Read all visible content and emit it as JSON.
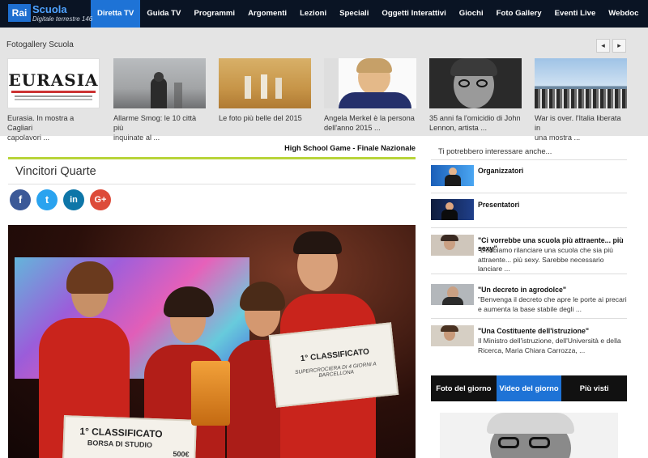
{
  "nav": {
    "logo_rai": "Rai",
    "logo_scuola": "Scuola",
    "logo_canale": "Digitale terrestre 146",
    "items": [
      {
        "label": "Diretta TV",
        "active": true
      },
      {
        "label": "Guida TV"
      },
      {
        "label": "Programmi"
      },
      {
        "label": "Argomenti"
      },
      {
        "label": "Lezioni"
      },
      {
        "label": "Speciali"
      },
      {
        "label": "Oggetti Interattivi"
      },
      {
        "label": "Giochi"
      },
      {
        "label": "Foto Gallery"
      },
      {
        "label": "Eventi Live"
      },
      {
        "label": "Webdoc"
      }
    ]
  },
  "gallery": {
    "title": "Fotogallery Scuola",
    "prev_icon": "chevron-left-icon",
    "next_icon": "chevron-right-icon",
    "prev_glyph": "◂",
    "next_glyph": "▸",
    "items": [
      {
        "line1": "Eurasia. In mostra a Cagliari",
        "line2": "capolavori ...",
        "thumb_text": "EURASIA"
      },
      {
        "line1": "Allarme Smog: le 10 città più",
        "line2": "inquinate al ..."
      },
      {
        "line1": "Le foto più belle del 2015",
        "line2": ""
      },
      {
        "line1": "Angela Merkel è la persona",
        "line2": "dell'anno 2015 ..."
      },
      {
        "line1": "35 anni fa l'omicidio di John",
        "line2": "Lennon, artista ..."
      },
      {
        "line1": "War is over. l'Italia liberata in",
        "line2": "una mostra ..."
      }
    ]
  },
  "article": {
    "section": "High School Game - Finale Nazionale",
    "title": "Vincitori Quarte",
    "share": {
      "facebook": "f",
      "twitter": "t",
      "linkedin": "in",
      "googleplus": "G+"
    },
    "photo_sign_left_1": "1° CLASSIFICATO",
    "photo_sign_left_2": "BORSA DI STUDIO",
    "photo_sign_left_3": "500€",
    "photo_sign_right_1": "1° CLASSIFICATO",
    "photo_sign_right_2": "SUPERCROCIERA DI 4 GIORNI A BARCELLONA"
  },
  "aside": {
    "heading": "Ti potrebbero interessare anche...",
    "items": [
      {
        "title": "Organizzatori",
        "desc": ""
      },
      {
        "title": "Presentatori",
        "desc": ""
      },
      {
        "title": "\"Ci vorrebbe una scuola più attraente... più sexy\"",
        "desc": "\"Dobbiamo rilanciare una scuola che sia più attraente... più sexy. Sarebbe necessario lanciare ..."
      },
      {
        "title": "\"Un decreto in agrodolce\"",
        "desc": "\"Benvenga il decreto che apre le porte ai precari e aumenta la base stabile degli ..."
      },
      {
        "title": "\"Una Costituente dell'istruzione\"",
        "desc": "Il Ministro dell'istruzione, dell'Università e della Ricerca, Maria Chiara Carrozza, ..."
      }
    ],
    "tabs": [
      {
        "label": "Foto del giorno"
      },
      {
        "label": "Video del giorno",
        "active": true
      },
      {
        "label": "Più visti"
      }
    ]
  }
}
